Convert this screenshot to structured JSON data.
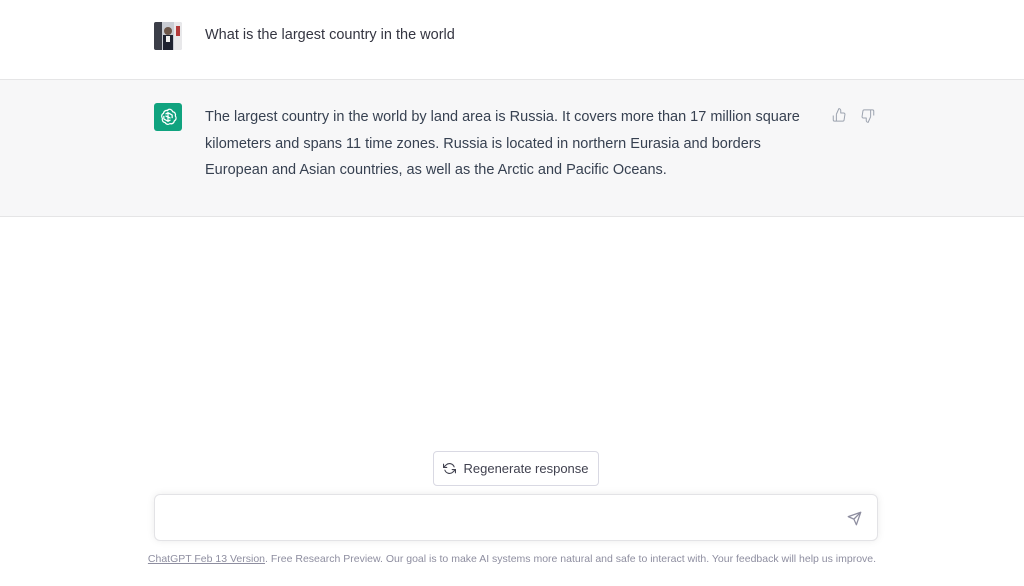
{
  "conversation": {
    "user_message": "What is the largest country in the world",
    "assistant_message": "The largest country in the world by land area is Russia. It covers more than 17 million square kilometers and spans 11 time zones. Russia is located in northern Eurasia and borders European and Asian countries, as well as the Arctic and Pacific Oceans."
  },
  "actions": {
    "regenerate_label": "Regenerate response"
  },
  "composer": {
    "value": "",
    "placeholder": ""
  },
  "footer": {
    "version_link": "ChatGPT Feb 13 Version",
    "disclaimer": ". Free Research Preview. Our goal is to make AI systems more natural and safe to interact with. Your feedback will help us improve."
  },
  "colors": {
    "accent": "#10a37f",
    "assistant_bg": "#f7f7f8",
    "text": "#343541"
  },
  "icons": {
    "assistant_avatar": "openai-logo-icon",
    "thumbs_up": "thumbs-up-icon",
    "thumbs_down": "thumbs-down-icon",
    "regenerate": "refresh-icon",
    "send": "send-icon"
  }
}
